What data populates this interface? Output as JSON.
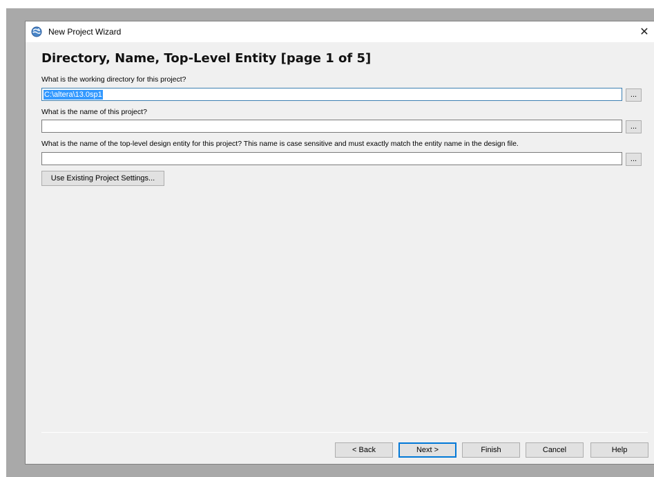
{
  "window": {
    "title": "New Project Wizard",
    "close_glyph": "✕"
  },
  "page": {
    "heading": "Directory, Name, Top-Level Entity [page 1 of 5]"
  },
  "fields": {
    "directory": {
      "label": "What is the working directory for this project?",
      "value": "C:\\altera\\13.0sp1",
      "browse_label": "..."
    },
    "project_name": {
      "label": "What is the name of this project?",
      "value": "",
      "browse_label": "..."
    },
    "top_level_entity": {
      "label": "What is the name of the top-level design entity for this project? This name is case sensitive and must exactly match the entity name in the design file.",
      "value": "",
      "browse_label": "..."
    }
  },
  "buttons": {
    "use_existing": "Use Existing Project Settings...",
    "back": "< Back",
    "next": "Next >",
    "finish": "Finish",
    "cancel": "Cancel",
    "help": "Help"
  },
  "icons": {
    "title_icon": "quartus-globe-icon",
    "close_icon": "close-icon"
  },
  "colors": {
    "selection": "#3399ff",
    "focus_border": "#3c7fb1",
    "default_button_border": "#0078d7"
  }
}
